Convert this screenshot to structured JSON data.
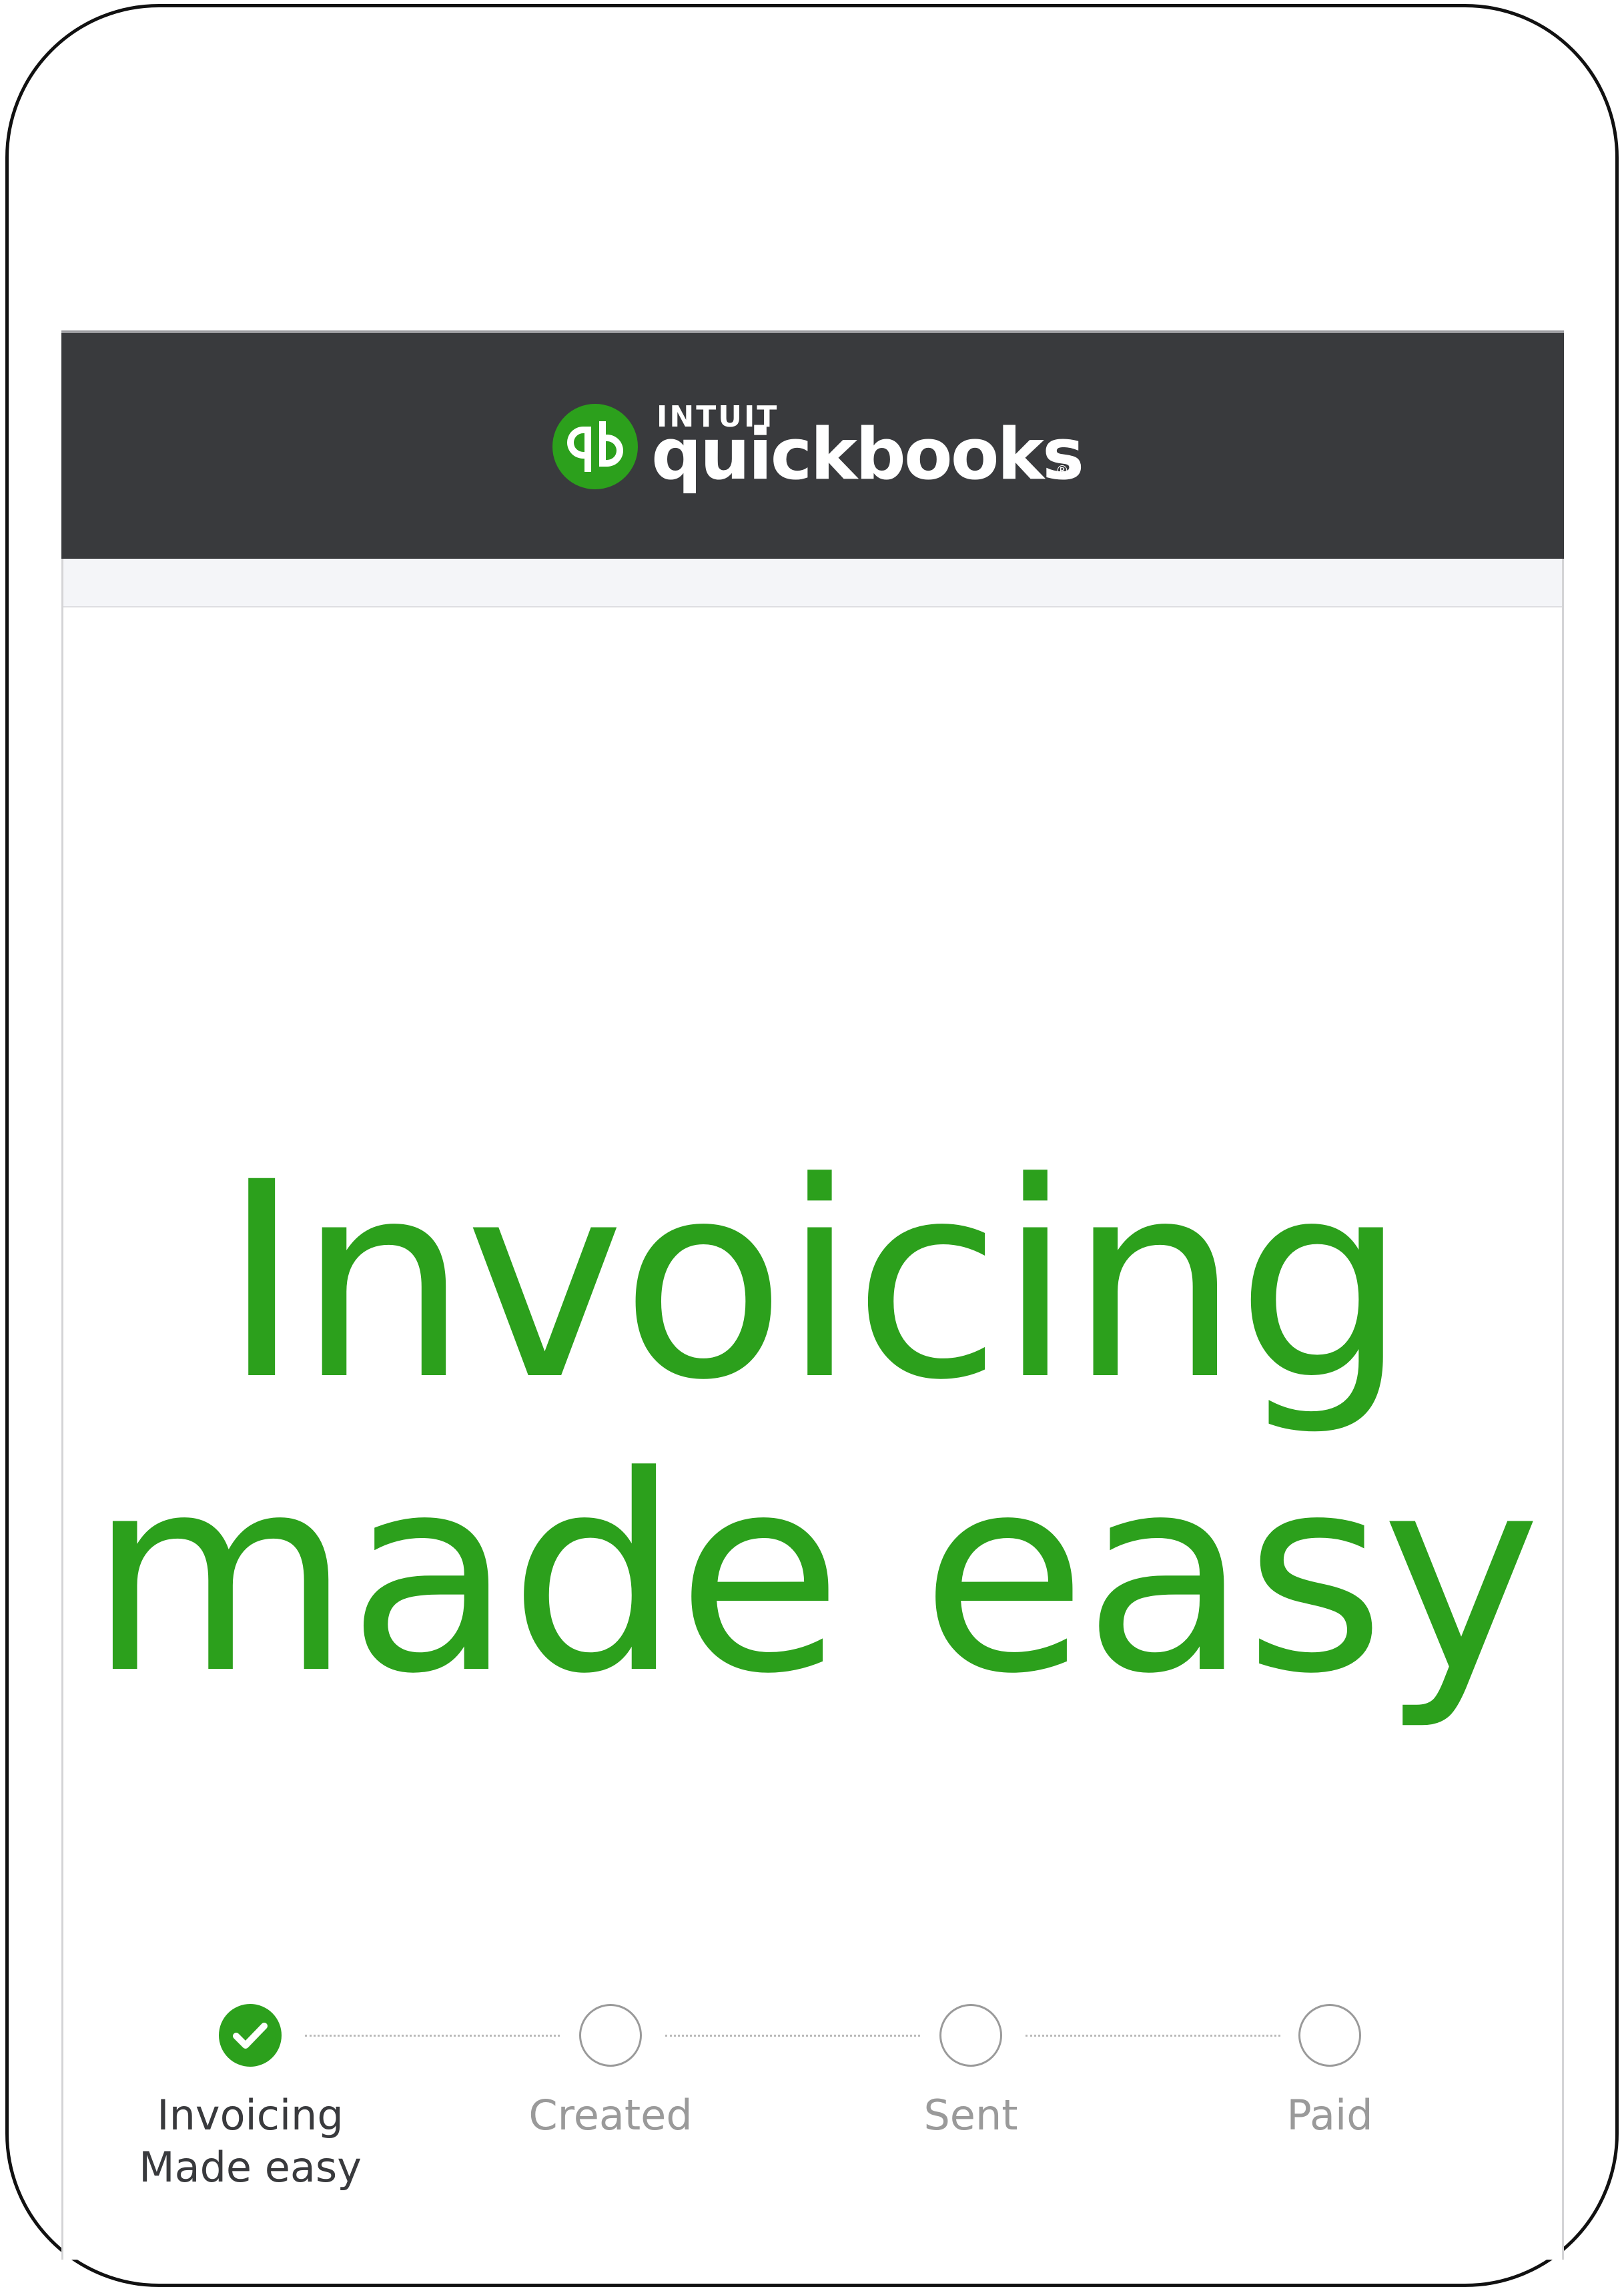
{
  "brand": {
    "intuit_label": "intuit",
    "wordmark": "quickbooks",
    "registered_mark": "®",
    "logo_icon": "quickbooks-qb-icon",
    "accent_color": "#2ca01c",
    "header_color": "#393a3d"
  },
  "hero": {
    "line1": "Invoicing",
    "line2": "made easy"
  },
  "stepper": {
    "steps": [
      {
        "label_line1": "Invoicing",
        "label_line2": "Made easy",
        "status": "complete",
        "icon": "checkmark-icon"
      },
      {
        "label_line1": "Created",
        "label_line2": "",
        "status": "pending",
        "icon": "empty-circle-icon"
      },
      {
        "label_line1": "Sent",
        "label_line2": "",
        "status": "pending",
        "icon": "empty-circle-icon"
      },
      {
        "label_line1": "Paid",
        "label_line2": "",
        "status": "pending",
        "icon": "empty-circle-icon"
      }
    ]
  }
}
